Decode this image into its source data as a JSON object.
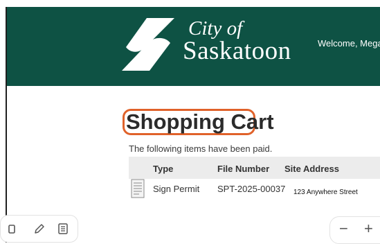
{
  "header": {
    "logo_city": "City of",
    "logo_name": "Saskatoon",
    "welcome": "Welcome, Mega",
    "color": "#0e5244"
  },
  "page": {
    "title": "Shopping Cart",
    "title_outline_color": "#e0622a",
    "paid_note": "The following items have been paid."
  },
  "cart_table": {
    "columns": [
      "Type",
      "File Number",
      "Site Address"
    ],
    "rows": [
      {
        "icon": "document-icon",
        "type": "Sign Permit",
        "file_number": "SPT-2025-00037",
        "site_address": "123 Anywhere Street"
      }
    ]
  },
  "annotation_toolbar": {
    "icons": [
      "trash-icon",
      "pencil-icon",
      "notes-icon"
    ]
  },
  "zoom_controls": {
    "zoom_out": "−",
    "zoom_in": "+"
  }
}
